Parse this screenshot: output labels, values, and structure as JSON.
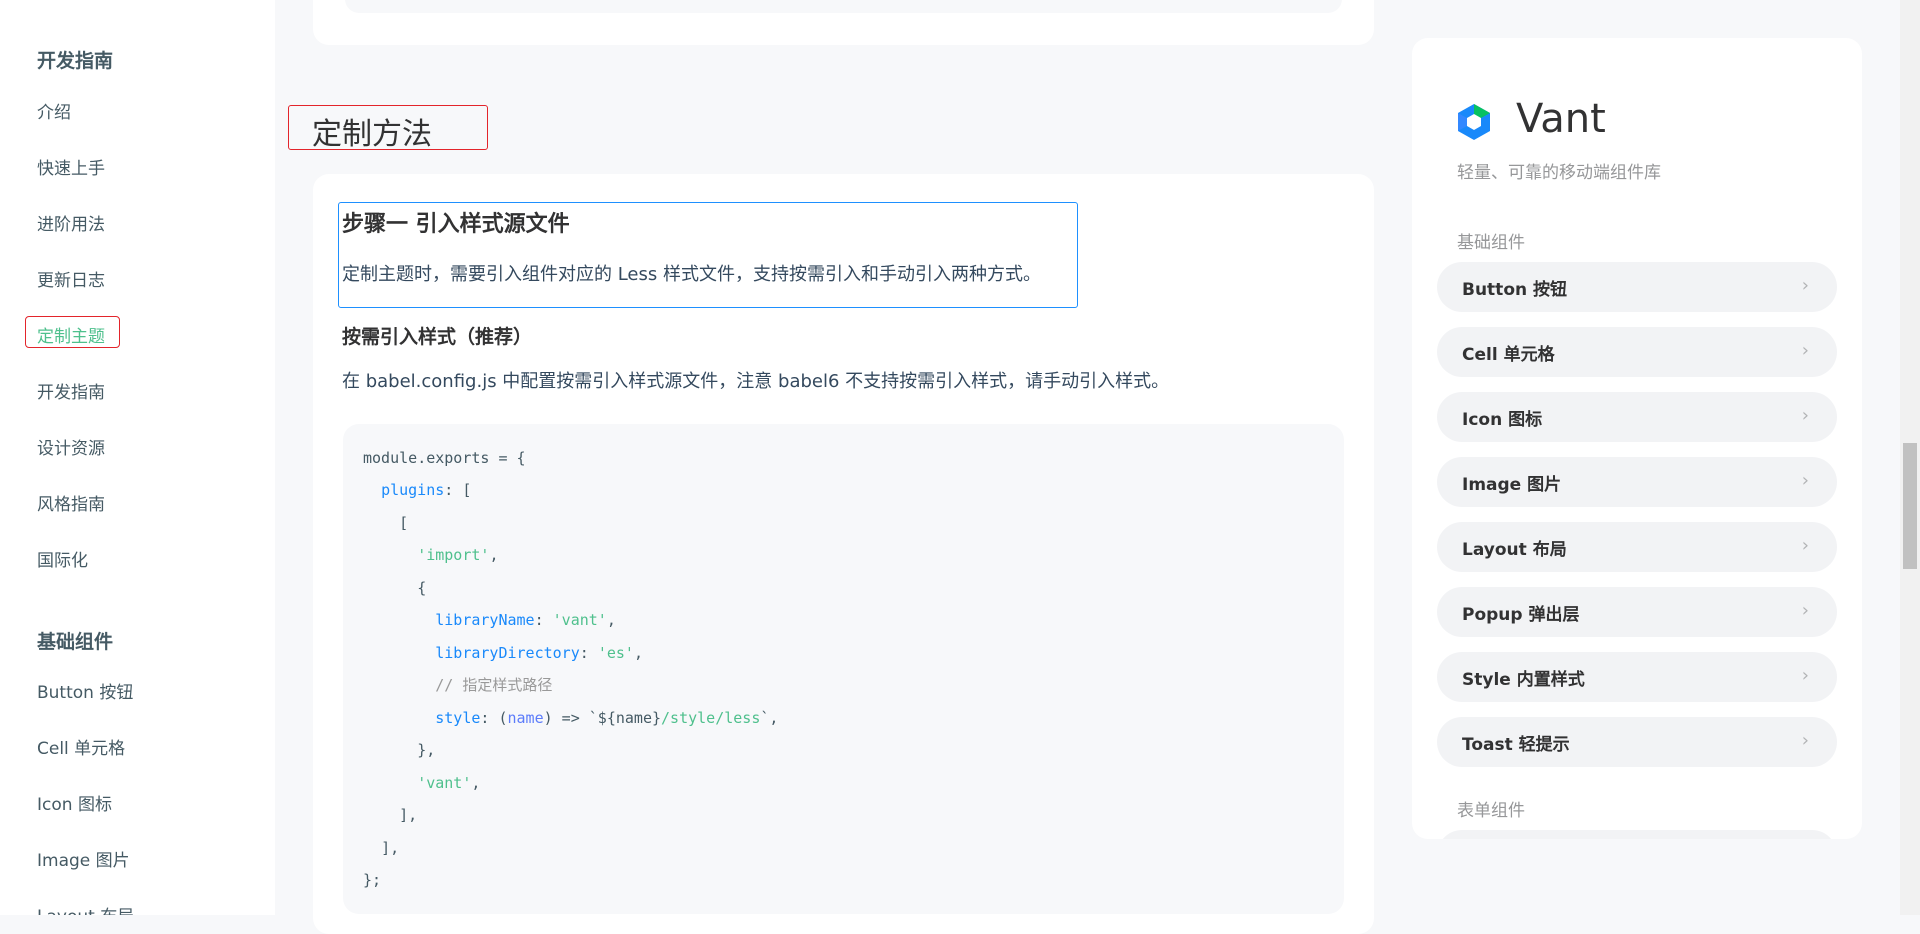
{
  "left_nav": {
    "groups": [
      {
        "title": "开发指南",
        "items": [
          "介绍",
          "快速上手",
          "进阶用法",
          "更新日志",
          "定制主题",
          "开发指南",
          "设计资源",
          "风格指南",
          "国际化"
        ]
      },
      {
        "title": "基础组件",
        "items": [
          "Button 按钮",
          "Cell 单元格",
          "Icon 图标",
          "Image 图片",
          "Layout 布局"
        ]
      }
    ],
    "active_item": "定制主题"
  },
  "content": {
    "section_title": "定制方法",
    "step_title": "步骤一 引入样式源文件",
    "step_desc": "定制主题时，需要引入组件对应的 Less 样式文件，支持按需引入和手动引入两种方式。",
    "sub_title": "按需引入样式（推荐）",
    "sub_desc": "在 babel.config.js 中配置按需引入样式源文件，注意 babel6 不支持按需引入样式，请手动引入样式。",
    "code": {
      "l1_a": "module",
      "l1_b": ".exports = {",
      "l2_key": "plugins",
      "l2_rest": ": [",
      "l3": "[",
      "l4_str": "'import'",
      "l4_rest": ",",
      "l5": "{",
      "l6_key": "libraryName",
      "l6_mid": ": ",
      "l6_str": "'vant'",
      "l6_end": ",",
      "l7_key": "libraryDirectory",
      "l7_mid": ": ",
      "l7_str": "'es'",
      "l7_end": ",",
      "l8_com": "// 指定样式路径",
      "l9_key": "style",
      "l9_a": ": (",
      "l9_par": "name",
      "l9_b": ") => `${name}",
      "l9_str": "/style/less",
      "l9_c": "`,",
      "l10": "},",
      "l11_str": "'vant'",
      "l11_rest": ",",
      "l12": "],",
      "l13": "],",
      "l14": "};"
    }
  },
  "phone": {
    "brand": "Vant",
    "desc": "轻量、可靠的移动端组件库",
    "group1": "基础组件",
    "items": [
      "Button 按钮",
      "Cell 单元格",
      "Icon 图标",
      "Image 图片",
      "Layout 布局",
      "Popup 弹出层",
      "Style 内置样式",
      "Toast 轻提示"
    ],
    "group2": "表单组件",
    "chevron": "›"
  },
  "colors": {
    "accent": "#4fc08d",
    "highlight_red": "#e3242b",
    "highlight_blue": "#1e90ff",
    "brand_blue": "#1989fa"
  }
}
